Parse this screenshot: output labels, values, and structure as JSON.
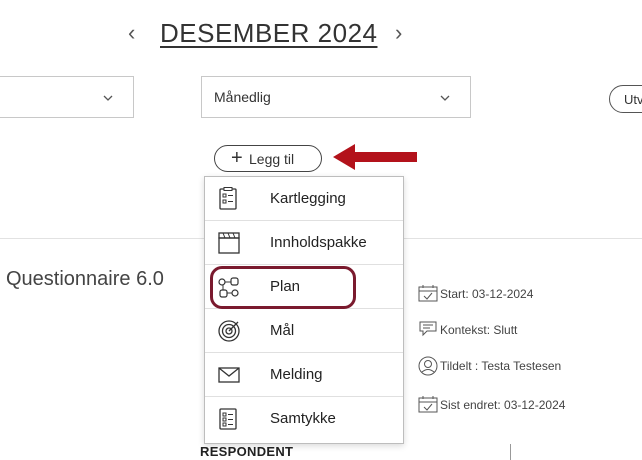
{
  "header": {
    "month_title": "DESEMBER 2024",
    "prev_label": "‹",
    "next_label": "›"
  },
  "filters": {
    "left_select_value": "",
    "frequency_value": "Månedlig",
    "right_button_label": "Utv"
  },
  "add_button": {
    "label": "Legg til",
    "plus": "+"
  },
  "menu": {
    "items": [
      {
        "label": "Kartlegging",
        "icon": "checklist-icon"
      },
      {
        "label": "Innholdspakke",
        "icon": "clapperboard-icon"
      },
      {
        "label": "Plan",
        "icon": "workflow-icon"
      },
      {
        "label": "Mål",
        "icon": "target-icon"
      },
      {
        "label": "Melding",
        "icon": "envelope-icon"
      },
      {
        "label": "Samtykke",
        "icon": "form-icon"
      }
    ]
  },
  "card": {
    "title": "Questionnaire 6.0",
    "start": "Start: 03-12-2024",
    "context": "Kontekst: Slutt",
    "assigned": "Tildelt : Testa Testesen",
    "last_changed": "Sist endret: 03-12-2024",
    "respondent_header": "RESPONDENT"
  },
  "colors": {
    "arrow": "#b3121b",
    "highlight": "#7a1a2e"
  }
}
